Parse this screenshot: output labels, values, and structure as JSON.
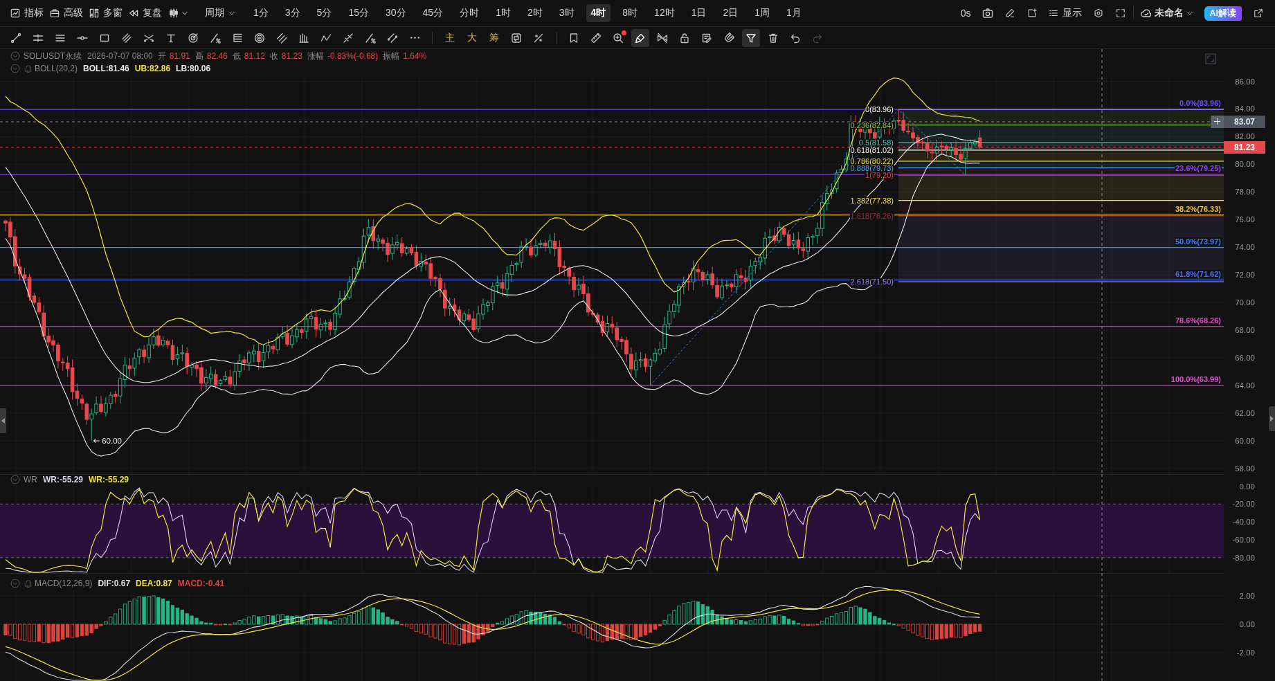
{
  "top_bar": {
    "indicators": "指标",
    "advanced": "高级",
    "multi_window": "多窗",
    "replay": "复盘",
    "period_menu": "周期",
    "periods": [
      {
        "label": "1分",
        "selected": false
      },
      {
        "label": "3分",
        "selected": false
      },
      {
        "label": "5分",
        "selected": false
      },
      {
        "label": "15分",
        "selected": false
      },
      {
        "label": "30分",
        "selected": false
      },
      {
        "label": "45分",
        "selected": false
      },
      {
        "label": "分时",
        "selected": false
      },
      {
        "label": "1时",
        "selected": false
      },
      {
        "label": "2时",
        "selected": false
      },
      {
        "label": "3时",
        "selected": false
      },
      {
        "label": "4时",
        "selected": true
      },
      {
        "label": "8时",
        "selected": false
      },
      {
        "label": "12时",
        "selected": false
      },
      {
        "label": "1日",
        "selected": false
      },
      {
        "label": "2日",
        "selected": false
      },
      {
        "label": "1周",
        "selected": false
      },
      {
        "label": "1月",
        "selected": false
      }
    ],
    "timer": "0s",
    "display": "显示",
    "layout_name": "未命名",
    "ai_button": "AI解读"
  },
  "draw_tools": [
    {
      "kind": "segment",
      "selected": false
    },
    {
      "kind": "parallel",
      "selected": false
    },
    {
      "kind": "hlines",
      "selected": false
    },
    {
      "kind": "hline",
      "selected": false
    },
    {
      "kind": "rect",
      "selected": false
    },
    {
      "kind": "channel",
      "selected": false
    },
    {
      "kind": "cross",
      "selected": false
    },
    {
      "kind": "text",
      "selected": false
    },
    {
      "kind": "target",
      "selected": false
    },
    {
      "kind": "pctline",
      "selected": false
    },
    {
      "kind": "stack",
      "selected": false
    },
    {
      "kind": "circles",
      "selected": false
    },
    {
      "kind": "diagonal",
      "selected": false
    },
    {
      "kind": "bars",
      "selected": false
    },
    {
      "kind": "zigzag",
      "selected": false
    },
    {
      "kind": "ticked",
      "selected": false
    },
    {
      "kind": "pctline",
      "selected": false
    },
    {
      "kind": "double",
      "selected": false
    },
    {
      "kind": "more",
      "selected": false
    }
  ],
  "mode_tools": [
    "主",
    "大",
    "筹"
  ],
  "chart_tools": [
    {
      "kind": "swap",
      "selected": false
    },
    {
      "kind": "measure",
      "selected": false
    }
  ],
  "edit_tools": [
    {
      "kind": "bookmark",
      "selected": false,
      "disabled": false,
      "badge": false
    },
    {
      "kind": "ruler",
      "selected": false,
      "disabled": false,
      "badge": false
    },
    {
      "kind": "zoom",
      "selected": false,
      "disabled": false,
      "badge": true
    },
    {
      "kind": "brush",
      "selected": true,
      "disabled": false,
      "badge": false
    },
    {
      "kind": "hide",
      "selected": false,
      "disabled": false,
      "badge": false
    },
    {
      "kind": "lock",
      "selected": false,
      "disabled": false,
      "badge": false
    },
    {
      "kind": "note",
      "selected": false,
      "disabled": false,
      "badge": false
    },
    {
      "kind": "magnet",
      "selected": false,
      "disabled": false,
      "badge": false
    },
    {
      "kind": "filter",
      "selected": true,
      "disabled": false,
      "badge": false
    },
    {
      "kind": "trash",
      "selected": false,
      "disabled": false,
      "badge": false
    },
    {
      "kind": "undo",
      "selected": false,
      "disabled": false,
      "badge": false
    },
    {
      "kind": "redo",
      "selected": false,
      "disabled": true,
      "badge": false
    }
  ],
  "main_pane": {
    "legend": {
      "symbol": "SOL/USDT永续",
      "time": "2026-07-07 08:00",
      "fields": [
        {
          "label": "开",
          "value": "81.91"
        },
        {
          "label": "高",
          "value": "82.46"
        },
        {
          "label": "低",
          "value": "81.12"
        },
        {
          "label": "收",
          "value": "81.23"
        },
        {
          "label": "涨幅",
          "value": "-0.83%(-0.68)"
        },
        {
          "label": "振幅",
          "value": "1.64%"
        }
      ]
    },
    "boll": {
      "name": "BOLL(20,2)",
      "values": [
        {
          "text": "BOLL:81.46",
          "color": "#e6e6e6"
        },
        {
          "text": "UB:82.86",
          "color": "#f2e33a"
        },
        {
          "text": "LB:80.06",
          "color": "#e6e6e6"
        }
      ]
    },
    "fib_retracement": [
      {
        "label": "0.0%(83.96)",
        "color": "#6a4bff"
      },
      {
        "label": "23.6%(79.25)",
        "color": "#9b3ff5"
      },
      {
        "label": "38.2%(76.33)",
        "color": "#f2c12e"
      },
      {
        "label": "50.0%(73.97)",
        "color": "#3f7fff"
      },
      {
        "label": "61.8%(71.62)",
        "color": "#4d6bff"
      },
      {
        "label": "78.6%(68.26)",
        "color": "#e04ac8"
      },
      {
        "label": "100.0%(63.99)",
        "color": "#e64fd6"
      }
    ],
    "fib_extension": [
      {
        "label": "0(83.96)",
        "color": "#ffffff"
      },
      {
        "label": "0.236(82.84)",
        "color": "#8bc34a"
      },
      {
        "label": "0.5(81.58)",
        "color": "#4fc3c3"
      },
      {
        "label": "0.618(81.02)",
        "color": "#f5f5f5"
      },
      {
        "label": "0.786(80.22)",
        "color": "#f2e02a"
      },
      {
        "label": "0.888(79.73)",
        "color": "#4aa8f5"
      },
      {
        "label": "1(79.20)",
        "color": "#f03e4a"
      },
      {
        "label": "1.382(77.38)",
        "color": "#f2e84a"
      },
      {
        "label": "1.618(76.26)",
        "color": "#a8243c"
      },
      {
        "label": "2.618(71.50)",
        "color": "#8f7cf5"
      }
    ],
    "low_marker": "60.00",
    "crosshair_price": "83.07",
    "last_price": "81.23",
    "axis_labels": [
      "86.00",
      "84.00",
      "82.00",
      "80.00",
      "78.00",
      "76.00",
      "74.00",
      "72.00",
      "70.00",
      "68.00",
      "66.00",
      "64.00",
      "62.00",
      "60.00",
      "58.00"
    ]
  },
  "wr_pane": {
    "name": "WR",
    "values": [
      {
        "text": "WR:-55.29",
        "color": "#dcd4ea"
      },
      {
        "text": "WR:-55.29",
        "color": "#f2e33a"
      }
    ],
    "axis_labels": [
      "0.00",
      "-20.00",
      "-40.00",
      "-60.00",
      "-80.00"
    ]
  },
  "macd_pane": {
    "name": "MACD(12,26,9)",
    "values": [
      {
        "text": "DIF:0.67",
        "color": "#e0e0e0"
      },
      {
        "text": "DEA:0.87",
        "color": "#f2e33a"
      },
      {
        "text": "MACD:-0.41",
        "color": "#d9443f"
      }
    ],
    "axis_labels": [
      "2.00",
      "0.00",
      "-2.00"
    ]
  }
}
